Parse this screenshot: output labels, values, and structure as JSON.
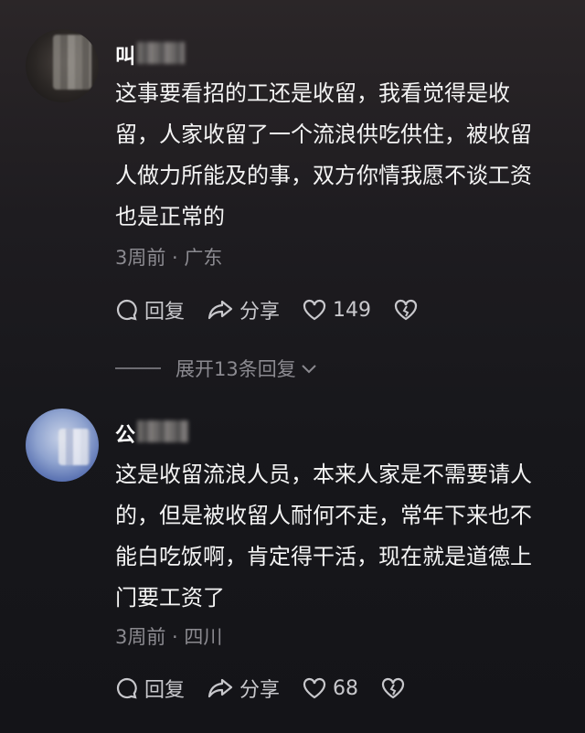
{
  "comments": [
    {
      "username": "叫",
      "text_lines": [
        "这事要看招的工还是收留，我看觉得是收",
        "留，人家收留了一个流浪供吃供住，被收留",
        "人做力所能及的事，双方你情我愿不谈工资",
        "也是正常的"
      ],
      "meta": "3周前 · 广东",
      "reply_label": "回复",
      "share_label": "分享",
      "likes": "149"
    },
    {
      "username": "公",
      "text_lines": [
        "这是收留流浪人员，本来人家是不需要请人",
        "的，但是被收留人耐何不走，常年下来也不",
        "能白吃饭啊，肯定得干活，现在就是道德上",
        "门要工资了"
      ],
      "meta": "3周前 · 四川",
      "reply_label": "回复",
      "share_label": "分享",
      "likes": "68"
    }
  ],
  "expand_replies": "展开13条回复"
}
